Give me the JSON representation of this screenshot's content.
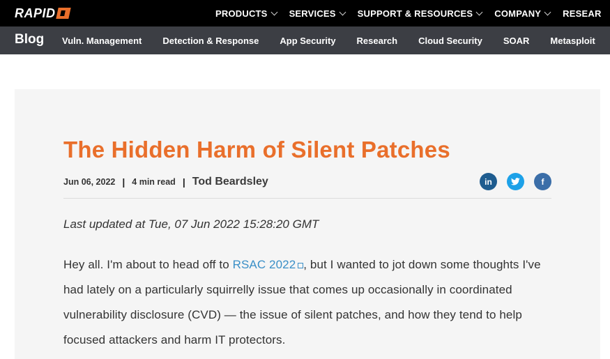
{
  "brand": {
    "logo_text": "RAPID",
    "accent": "#e96f2b"
  },
  "topnav": {
    "items": [
      {
        "label": "PRODUCTS"
      },
      {
        "label": "SERVICES"
      },
      {
        "label": "SUPPORT & RESOURCES"
      },
      {
        "label": "COMPANY"
      },
      {
        "label": "RESEAR"
      }
    ]
  },
  "blognav": {
    "title": "Blog",
    "items": [
      {
        "label": "Vuln. Management"
      },
      {
        "label": "Detection & Response"
      },
      {
        "label": "App Security"
      },
      {
        "label": "Research"
      },
      {
        "label": "Cloud Security"
      },
      {
        "label": "SOAR"
      },
      {
        "label": "Metasploit"
      }
    ]
  },
  "article": {
    "title": "The Hidden Harm of Silent Patches",
    "date": "Jun 06, 2022",
    "read_time": "4 min read",
    "author": "Tod Beardsley",
    "updated": "Last updated at Tue, 07 Jun 2022 15:28:20 GMT",
    "para_before_link": "Hey all. I'm about to head off to ",
    "link_text": "RSAC 2022",
    "para_after_link": ", but I wanted to jot down some thoughts I've had lately on a particularly squirrelly issue that comes up occasionally in coordinated vulnerability disclosure (CVD) — the issue of silent patches, and how they tend to help focused attackers and harm IT protectors."
  },
  "share": {
    "linkedin_glyph": "in",
    "twitter_glyph": "t",
    "facebook_glyph": "f",
    "icons": [
      "linkedin-icon",
      "twitter-icon",
      "facebook-icon"
    ]
  }
}
